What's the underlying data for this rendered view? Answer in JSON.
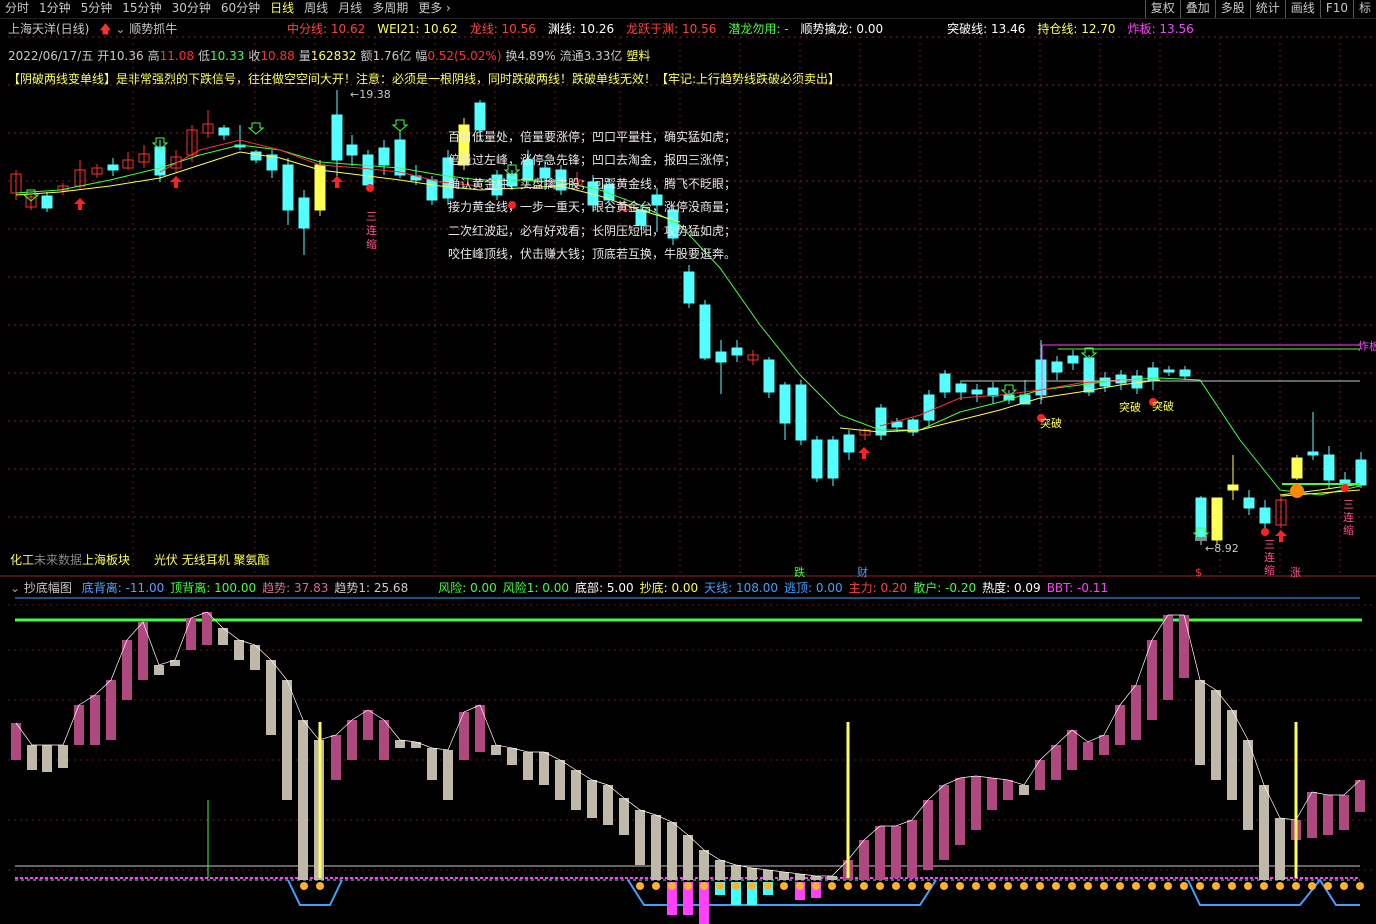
{
  "toolbar": {
    "tabs": [
      "分时",
      "1分钟",
      "5分钟",
      "15分钟",
      "30分钟",
      "60分钟",
      "日线",
      "周线",
      "月线",
      "多周期",
      "更多"
    ],
    "active_tab": "日线",
    "right_buttons": [
      "复权",
      "叠加",
      "多股",
      "统计",
      "画线",
      "F10",
      "标"
    ]
  },
  "header": {
    "stock": "上海天洋(日线)",
    "formula": "顺势抓牛",
    "values": [
      {
        "label": "中分线:",
        "value": "10.62",
        "color": "#ff4040"
      },
      {
        "label": "WEI21:",
        "value": "10.62",
        "color": "#ffff54"
      },
      {
        "label": "龙线:",
        "value": "10.56",
        "color": "#ff4040"
      },
      {
        "label": "渊线:",
        "value": "10.26",
        "color": "#ffffff"
      },
      {
        "label": "龙跃于渊:",
        "value": "10.56",
        "color": "#ff4040"
      },
      {
        "label": "潜龙勿用:",
        "value": "-",
        "color": "#40ff40"
      },
      {
        "label": "顺势擒龙:",
        "value": "0.00",
        "color": "#ffffff"
      },
      {
        "label": "突破线:",
        "value": "13.46",
        "color": "#ffffff"
      },
      {
        "label": "持仓线:",
        "value": "12.70",
        "color": "#ffff54"
      },
      {
        "label": "炸板:",
        "value": "13.56",
        "color": "#ff40ff"
      }
    ]
  },
  "quote": {
    "date": "2022/06/17/五",
    "open_label": "开",
    "open": "10.36",
    "high_label": "高",
    "high": "11.08",
    "low_label": "低",
    "low": "10.33",
    "close_label": "收",
    "close": "10.88",
    "vol_label": "量",
    "vol": "162832",
    "amt_label": "额",
    "amt": "1.76亿",
    "chg_label": "幅",
    "chg": "0.52(5.02%)",
    "turn_label": "换",
    "turn": "4.89%",
    "float_label": "流通",
    "float": "3.33亿",
    "sector": "塑料"
  },
  "notice": "【阴破两线变单线】是非常强烈的下跌信号，往往做空空间大开！注意：必须是一根阴线，同时跌破两线！跌破单线无效！【牢记:上行趋势线跌破必须卖出】",
  "verses": [
    "百日低量处，倍量要涨停；凹口平量柱，确实猛如虎；",
    "倍量过左峰，涨停急先锋；凹口去淘金，报四三涨停；",
    "确认黄金柱，买盘擒牛股；回踩黄金线，腾飞不眨眼；",
    "接力黄金线，一步一重天；眼谷黄金台，涨停没商量；",
    "二次红波起，必有好戏看；长阴压短阳，攻势猛如虎；",
    "咬住峰顶线，伏击赚大钱；顶底若互换，牛股要逛奔。"
  ],
  "chart_labels": {
    "high_price": "19.38",
    "low_price": "8.92",
    "break_label": "突破",
    "three_shrink": "三连缩",
    "zhaban_tag": "炸板",
    "die": "跌",
    "cai": "财",
    "zhang": "涨",
    "dollar": "$"
  },
  "footer_text": {
    "left": "化工",
    "future": "未来数据",
    "sector": "上海板块",
    "concepts": "光伏 无线耳机 聚氨酯"
  },
  "indicator": {
    "name": "抄底幅图",
    "values": [
      {
        "label": "底背离:",
        "value": "-11.00",
        "color": "#5aa0ff"
      },
      {
        "label": "顶背离:",
        "value": "100.00",
        "color": "#40ff40"
      },
      {
        "label": "趋势:",
        "value": "37.83",
        "color": "#d07090"
      },
      {
        "label": "趋势1:",
        "value": "25.68",
        "color": "#c8c8c8"
      },
      {
        "label": "风险:",
        "value": "0.00",
        "color": "#40ff40"
      },
      {
        "label": "风险1:",
        "value": "0.00",
        "color": "#40ff40"
      },
      {
        "label": "底部:",
        "value": "5.00",
        "color": "#ffffff"
      },
      {
        "label": "抄底:",
        "value": "0.00",
        "color": "#ffff54"
      },
      {
        "label": "天线:",
        "value": "108.00",
        "color": "#40a0ff"
      },
      {
        "label": "逃顶:",
        "value": "0.00",
        "color": "#40a0ff"
      },
      {
        "label": "主力:",
        "value": "0.20",
        "color": "#ff4040"
      },
      {
        "label": "散户:",
        "value": "-0.20",
        "color": "#40ff40"
      },
      {
        "label": "热度:",
        "value": "0.09",
        "color": "#ffffff"
      },
      {
        "label": "BBT:",
        "value": "-0.11",
        "color": "#ff40ff"
      }
    ]
  },
  "colors": {
    "up": "#ff3030",
    "down": "#54ffff",
    "ma_yellow": "#ffff54",
    "ma_green": "#40ff40",
    "accent_pink": "#b04880",
    "grey_bar": "#c0b8a8"
  }
}
